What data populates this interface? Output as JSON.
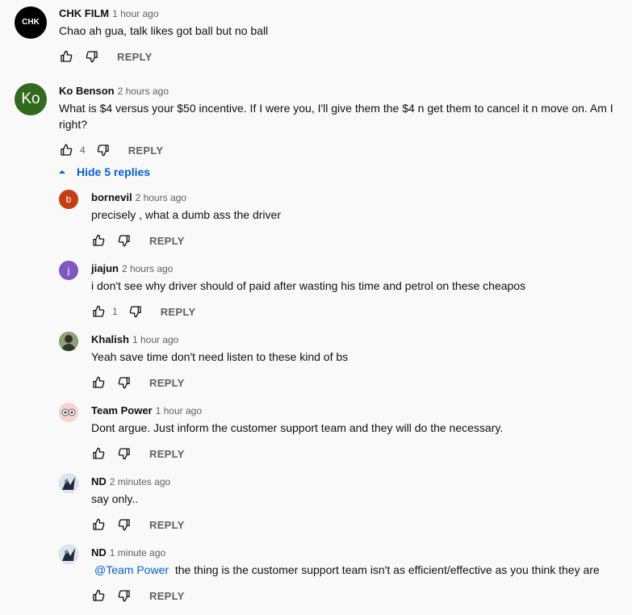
{
  "comments": [
    {
      "author": "CHK FILM",
      "time": "1 hour ago",
      "text": "Chao ah gua, talk likes got ball but no ball",
      "likes": "",
      "reply_label": "REPLY",
      "avatar": {
        "logo_text": "CHK",
        "bg": "#000000"
      }
    },
    {
      "author": "Ko Benson",
      "time": "2 hours ago",
      "text": "What is $4 versus your $50 incentive. If I were you, I'll give them the $4 n get them to cancel it n move on. Am I right?",
      "likes": "4",
      "reply_label": "REPLY",
      "avatar": {
        "initials": "Ko",
        "bg": "#33691e"
      }
    }
  ],
  "replies_toggle": {
    "label": "Hide 5 replies"
  },
  "replies": [
    {
      "author": "bornevil",
      "time": "2 hours ago",
      "text": "precisely , what a dumb ass the driver",
      "likes": "",
      "reply_label": "REPLY",
      "avatar": {
        "initials": "b",
        "bg": "#c53d14"
      }
    },
    {
      "author": "jiajun",
      "time": "2 hours ago",
      "text": "i don't see why driver should of paid after wasting his time and petrol on these cheapos",
      "likes": "1",
      "reply_label": "REPLY",
      "avatar": {
        "initials": "j",
        "bg": "#7e57c2"
      }
    },
    {
      "author": "Khalish",
      "time": "1 hour ago",
      "text": "Yeah save time don't need listen to these kind of bs",
      "likes": "",
      "reply_label": "REPLY",
      "avatar": {
        "bg": "#6d7f5a"
      }
    },
    {
      "author": "Team Power",
      "time": "1 hour ago",
      "text": "Dont argue. Just inform the customer support team and they will do the necessary.",
      "likes": "",
      "reply_label": "REPLY",
      "avatar": {
        "bg": "#f3c6c6"
      }
    },
    {
      "author": "ND",
      "time": "2 minutes ago",
      "text": "say only..",
      "likes": "",
      "reply_label": "REPLY",
      "avatar": {
        "bg": "#3c4a5c"
      }
    },
    {
      "author": "ND",
      "time": "1 minute ago",
      "mention": "@Team Power",
      "text": "the thing is the customer support team isn't as efficient/effective as you think they are",
      "likes": "",
      "reply_label": "REPLY",
      "avatar": {
        "bg": "#3c4a5c"
      }
    }
  ],
  "colors": {
    "background": "#f9f9f9",
    "text": "#0f0f0f",
    "secondary": "#606060",
    "link": "#065fd4"
  },
  "icons": [
    "thumbs-up-icon",
    "thumbs-down-icon",
    "caret-up-icon"
  ]
}
